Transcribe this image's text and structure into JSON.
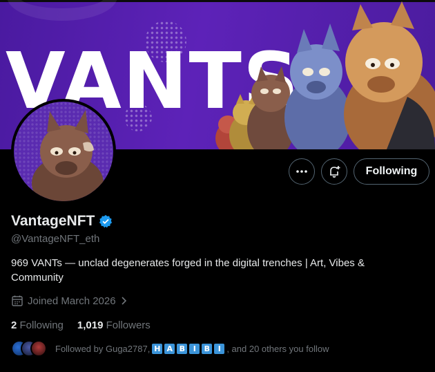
{
  "banner": {
    "title": "VANTS"
  },
  "profile": {
    "display_name": "VantageNFT",
    "handle": "@VantageNFT_eth",
    "bio": "969 VANTs — unclad degenerates forged in the digital trenches | Art, Vibes & Community",
    "joined": "Joined March 2026"
  },
  "actions": {
    "follow_label": "Following"
  },
  "stats": {
    "following_count": "2",
    "following_label": "Following",
    "followers_count": "1,019",
    "followers_label": "Followers"
  },
  "followed_by": {
    "prefix": "Followed by Guga2787,",
    "letters": [
      "H",
      "A",
      "B",
      "I",
      "B",
      "I"
    ],
    "suffix": ", and 20 others you follow"
  },
  "colors": {
    "verified": "#1d9bf0",
    "banner_bg": "#5d22b8",
    "badge": "#3b94d9"
  },
  "icons": {
    "more": "more-icon",
    "notify": "bell-plus-icon",
    "calendar": "calendar-icon",
    "chevron": "chevron-right-icon",
    "verified": "verified-badge-icon"
  }
}
